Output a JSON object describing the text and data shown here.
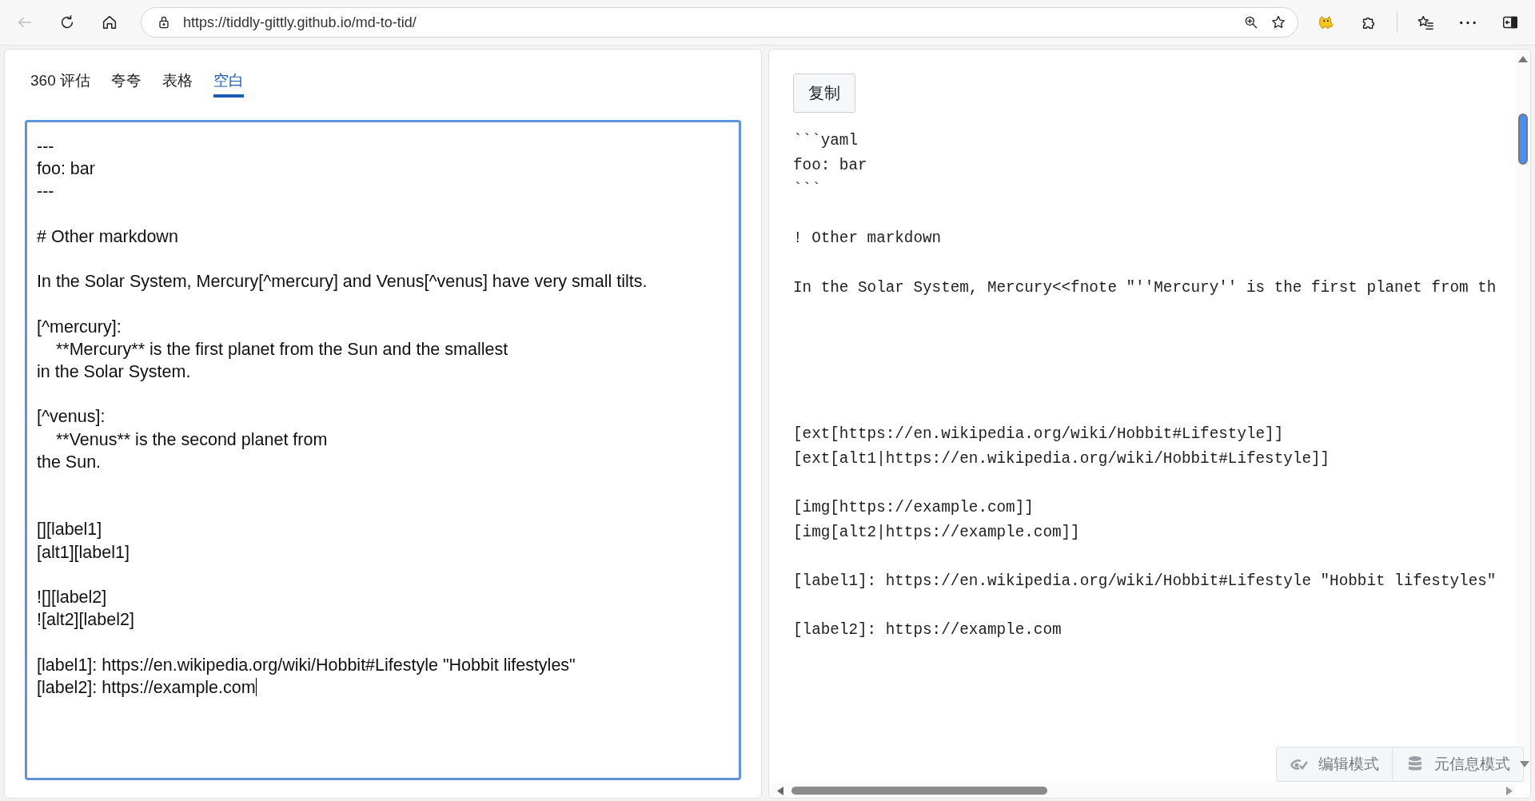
{
  "browser": {
    "back_disabled": true,
    "url": "https://tiddly-gittly.github.io/md-to-tid/"
  },
  "tabs": [
    {
      "label": "360 评估",
      "selected": false
    },
    {
      "label": "夸夸",
      "selected": false
    },
    {
      "label": "表格",
      "selected": false
    },
    {
      "label": "空白",
      "selected": true
    }
  ],
  "editor": {
    "value": "---\nfoo: bar\n---\n\n# Other markdown\n\nIn the Solar System, Mercury[^mercury] and Venus[^venus] have very small tilts.\n\n[^mercury]:\n    **Mercury** is the first planet from the Sun and the smallest\nin the Solar System.\n\n[^venus]:\n    **Venus** is the second planet from\nthe Sun.\n\n\n[][label1]\n[alt1][label1]\n\n![][label2]\n![alt2][label2]\n\n[label1]: https://en.wikipedia.org/wiki/Hobbit#Lifestyle \"Hobbit lifestyles\"\n[label2]: https://example.com"
  },
  "copy_button": "复制",
  "output": "```yaml\nfoo: bar\n```\n\n! Other markdown\n\nIn the Solar System, Mercury<<fnote \"''Mercury'' is the first planet from th\n\n\n\n\n\n[ext[https://en.wikipedia.org/wiki/Hobbit#Lifestyle]]\n[ext[alt1|https://en.wikipedia.org/wiki/Hobbit#Lifestyle]]\n\n[img[https://example.com]]\n[img[alt2|https://example.com]]\n\n[label1]: https://en.wikipedia.org/wiki/Hobbit#Lifestyle \"Hobbit lifestyles\"\n\n[label2]: https://example.com",
  "mode_buttons": [
    {
      "kind": "edit",
      "label": "编辑模式"
    },
    {
      "kind": "meta",
      "label": "元信息模式"
    }
  ]
}
